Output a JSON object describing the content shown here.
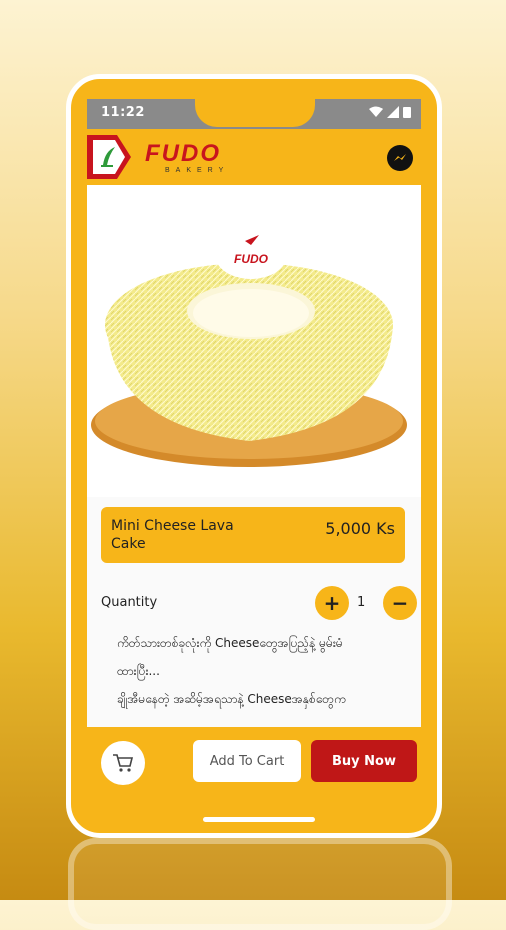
{
  "status_bar": {
    "time": "11:22"
  },
  "header": {
    "brand_name": "FUDO",
    "brand_sub": "BAKERY",
    "messenger_icon": "messenger-icon"
  },
  "product": {
    "image_topper_text": "FUDO",
    "name": "Mini Cheese Lava Cake",
    "price": "5,000 Ks"
  },
  "quantity": {
    "label": "Quantity",
    "value": "1",
    "increase_label": "+",
    "decrease_label": "−"
  },
  "description": {
    "line1": "ကိတ်သားတစ်ခုလုံးကို Cheeseတွေအပြည့်နဲ့ မွမ်းမံ",
    "line2": "ထားပြီး...",
    "line3": "ချိုအီမနေတဲ့ အဆိမ့်အရသာနဲ့ Cheeseအနှစ်တွေက"
  },
  "actions": {
    "add_to_cart": "Add To Cart",
    "buy_now": "Buy Now",
    "cart_icon": "cart-icon"
  },
  "colors": {
    "accent": "#f7b519",
    "buy": "#bf1717",
    "brand": "#c8141e"
  }
}
